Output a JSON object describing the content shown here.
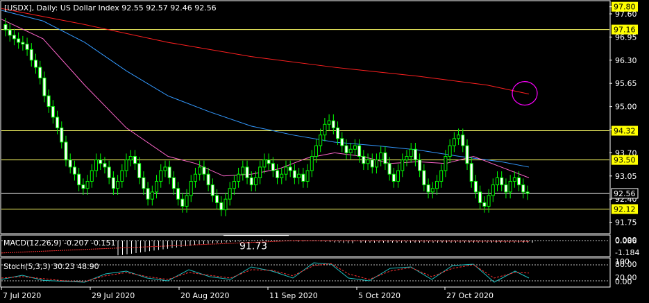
{
  "header": {
    "symbol_line": "[USDX], Daily:  US Dollar Index  92.55 92.57 92.46 92.56"
  },
  "colors": {
    "background": "#000000",
    "grid": "#ffffff",
    "candle": "#00ff00",
    "ma_slow": "#ff2020",
    "ma_mid": "#3399ff",
    "ma_fast": "#ff66cc",
    "hline": "#ffff66",
    "price_tag_bg": "#ffff00",
    "circle": "#ff00ff",
    "macd_signal": "#ff3333",
    "stoch_main": "#20c0c0",
    "stoch_signal": "#ff3333"
  },
  "chart_data": {
    "type": "candlestick",
    "x_labels": [
      "7 Jul 2020",
      "29 Jul 2020",
      "20 Aug 2020",
      "11 Sep 2020",
      "5 Oct 2020",
      "27 Oct 2020"
    ],
    "y_ticks": [
      "97.80",
      "97.60",
      "96.95",
      "96.30",
      "95.65",
      "95.00",
      "94.35",
      "93.70",
      "93.05",
      "92.40",
      "91.75"
    ],
    "ylim": [
      91.45,
      97.95
    ],
    "price_tags": [
      {
        "label": "97.80",
        "value": 97.8,
        "line": false
      },
      {
        "label": "97.16",
        "value": 97.16,
        "line": true
      },
      {
        "label": "94.32",
        "value": 94.32,
        "line": true
      },
      {
        "label": "93.50",
        "value": 93.5,
        "line": true
      },
      {
        "label": "92.56",
        "value": 92.56,
        "line": true,
        "current": true
      },
      {
        "label": "92.12",
        "value": 92.12,
        "line": true
      }
    ],
    "annotation": {
      "text": "91.73",
      "value": 91.73
    },
    "closes": [
      97.15,
      97.0,
      96.9,
      96.8,
      96.75,
      96.6,
      96.3,
      96.1,
      95.8,
      95.3,
      95.0,
      94.7,
      94.4,
      94.0,
      93.5,
      93.3,
      93.1,
      92.8,
      92.7,
      92.9,
      93.2,
      93.5,
      93.4,
      93.3,
      93.0,
      92.7,
      92.9,
      93.2,
      93.5,
      93.6,
      93.4,
      93.0,
      92.7,
      92.4,
      92.6,
      92.9,
      93.2,
      93.3,
      93.0,
      92.7,
      92.4,
      92.2,
      92.5,
      92.9,
      93.1,
      93.3,
      93.1,
      92.8,
      92.5,
      92.3,
      92.1,
      92.4,
      92.7,
      92.9,
      93.1,
      93.3,
      93.0,
      92.8,
      93.0,
      93.3,
      93.5,
      93.4,
      93.2,
      93.0,
      93.1,
      93.3,
      93.2,
      93.0,
      93.1,
      92.9,
      93.2,
      93.6,
      93.9,
      94.2,
      94.5,
      94.6,
      94.4,
      94.1,
      93.9,
      93.7,
      93.8,
      93.9,
      93.6,
      93.4,
      93.5,
      93.3,
      93.5,
      93.7,
      93.4,
      93.1,
      92.9,
      93.2,
      93.5,
      93.6,
      93.8,
      93.5,
      93.2,
      92.8,
      92.6,
      92.7,
      92.9,
      93.2,
      93.6,
      93.9,
      94.1,
      94.2,
      93.9,
      93.4,
      92.9,
      92.6,
      92.3,
      92.2,
      92.5,
      92.8,
      93.0,
      92.8,
      92.6,
      92.9,
      93.0,
      92.8,
      92.6,
      92.56
    ],
    "ma_slow": [
      [
        0,
        97.75
      ],
      [
        120,
        97.3
      ],
      [
        240,
        96.8
      ],
      [
        360,
        96.4
      ],
      [
        480,
        96.1
      ],
      [
        600,
        95.85
      ],
      [
        700,
        95.6
      ],
      [
        760,
        95.35
      ]
    ],
    "ma_mid": [
      [
        0,
        97.7
      ],
      [
        60,
        97.4
      ],
      [
        120,
        96.8
      ],
      [
        180,
        96.0
      ],
      [
        240,
        95.3
      ],
      [
        300,
        94.85
      ],
      [
        360,
        94.45
      ],
      [
        420,
        94.2
      ],
      [
        480,
        94.0
      ],
      [
        540,
        93.9
      ],
      [
        600,
        93.78
      ],
      [
        660,
        93.6
      ],
      [
        720,
        93.45
      ],
      [
        760,
        93.3
      ]
    ],
    "ma_fast": [
      [
        0,
        97.45
      ],
      [
        60,
        96.9
      ],
      [
        120,
        95.6
      ],
      [
        180,
        94.4
      ],
      [
        240,
        93.6
      ],
      [
        280,
        93.4
      ],
      [
        320,
        93.05
      ],
      [
        360,
        93.1
      ],
      [
        400,
        93.25
      ],
      [
        440,
        93.55
      ],
      [
        480,
        93.7
      ],
      [
        520,
        93.6
      ],
      [
        560,
        93.4
      ],
      [
        600,
        93.45
      ],
      [
        640,
        93.4
      ],
      [
        680,
        93.6
      ],
      [
        720,
        93.3
      ],
      [
        760,
        93.0
      ]
    ],
    "circle_anchor": {
      "index": "ma_slow_end",
      "value": 95.35
    },
    "macd": {
      "label": "MACD(12,26,9) -0.207 -0.151",
      "axis_labels": [
        "0.000",
        "0.086",
        "-1.184"
      ],
      "histogram": [
        -1.18,
        -1.15,
        -1.1,
        -1.05,
        -1.0,
        -0.95,
        -0.9,
        -0.85,
        -0.8,
        -0.75,
        -0.7,
        -0.65,
        -0.6,
        -0.55,
        -0.5,
        -0.45,
        -0.4,
        -0.35,
        -0.3,
        -0.28,
        -0.25,
        -0.22,
        -0.2,
        -0.18,
        -0.15,
        -0.12,
        -0.1,
        -0.08,
        -0.05,
        -0.03,
        0.02,
        0.05,
        0.08,
        0.06,
        0.04,
        0.02,
        0.0,
        -0.02,
        -0.04,
        -0.06,
        -0.08,
        -0.06,
        -0.05,
        -0.04,
        -0.05,
        -0.07,
        -0.1,
        -0.12,
        -0.15,
        -0.17,
        -0.18,
        -0.2,
        -0.21
      ]
    },
    "stoch": {
      "label": "Stoch(5,3,3) 30.23 48.90",
      "axis_labels": [
        "100",
        "80.00",
        "20.00",
        "0.00"
      ],
      "main": [
        [
          0,
          25
        ],
        [
          30,
          40
        ],
        [
          60,
          22
        ],
        [
          90,
          18
        ],
        [
          120,
          15
        ],
        [
          150,
          45
        ],
        [
          180,
          55
        ],
        [
          210,
          30
        ],
        [
          240,
          20
        ],
        [
          270,
          60
        ],
        [
          300,
          35
        ],
        [
          330,
          25
        ],
        [
          360,
          70
        ],
        [
          390,
          55
        ],
        [
          420,
          30
        ],
        [
          450,
          85
        ],
        [
          475,
          80
        ],
        [
          500,
          30
        ],
        [
          530,
          20
        ],
        [
          560,
          65
        ],
        [
          590,
          70
        ],
        [
          620,
          25
        ],
        [
          650,
          75
        ],
        [
          680,
          80
        ],
        [
          710,
          15
        ],
        [
          740,
          55
        ],
        [
          760,
          30
        ]
      ],
      "signal": [
        [
          0,
          30
        ],
        [
          30,
          35
        ],
        [
          60,
          28
        ],
        [
          90,
          20
        ],
        [
          120,
          18
        ],
        [
          150,
          38
        ],
        [
          180,
          50
        ],
        [
          210,
          35
        ],
        [
          240,
          25
        ],
        [
          270,
          50
        ],
        [
          300,
          40
        ],
        [
          330,
          30
        ],
        [
          360,
          60
        ],
        [
          390,
          58
        ],
        [
          420,
          38
        ],
        [
          450,
          75
        ],
        [
          475,
          82
        ],
        [
          500,
          45
        ],
        [
          530,
          25
        ],
        [
          560,
          55
        ],
        [
          590,
          68
        ],
        [
          620,
          35
        ],
        [
          650,
          65
        ],
        [
          680,
          78
        ],
        [
          710,
          30
        ],
        [
          740,
          50
        ],
        [
          760,
          48
        ]
      ]
    }
  }
}
